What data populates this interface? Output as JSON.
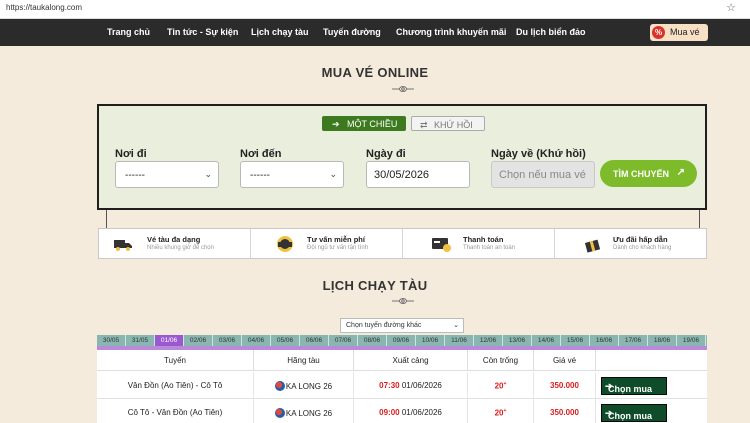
{
  "browser": {
    "url": "https://taukalong.com"
  },
  "nav": {
    "items": [
      "Trang chủ",
      "Tin tức - Sự kiện",
      "Lịch chạy tàu",
      "Tuyến đường",
      "Chương trình khuyến mãi",
      "Du lịch biển đảo"
    ],
    "buy_label": "Mua vé",
    "buy_icon": "%"
  },
  "booking": {
    "title": "MUA VÉ ONLINE",
    "tab_oneway": "MỘT CHIỀU",
    "tab_return": "KHỨ HỒI",
    "from_label": "Nơi đi",
    "from_value": "------",
    "to_label": "Nơi đến",
    "to_value": "------",
    "depart_label": "Ngày đi",
    "depart_value": "30/05/2026",
    "return_label": "Ngày về (Khứ hồi)",
    "return_placeholder": "Chọn nếu mua vé",
    "find_label": "TÌM CHUYẾN",
    "accent": "#7dbb2a"
  },
  "features": [
    {
      "title": "Vé tàu đa dạng",
      "sub": "Nhiều khung giờ để chọn",
      "icon": "truck-icon"
    },
    {
      "title": "Tư vấn miễn phí",
      "sub": "Đội ngũ tư vấn tận tình",
      "icon": "headset-icon"
    },
    {
      "title": "Thanh toán",
      "sub": "Thanh toán an toàn",
      "icon": "card-icon"
    },
    {
      "title": "Ưu đãi hấp dẫn",
      "sub": "Dành cho khách hàng",
      "icon": "gift-icon"
    }
  ],
  "schedule": {
    "title": "LỊCH CHẠY TÀU",
    "route_select": "Chọn tuyến đường khác",
    "dates": [
      "30/05",
      "31/05",
      "01/06",
      "02/06",
      "03/06",
      "04/06",
      "05/06",
      "06/06",
      "07/06",
      "08/06",
      "09/06",
      "10/06",
      "11/06",
      "12/06",
      "13/06",
      "14/06",
      "15/06",
      "16/06",
      "17/06",
      "18/06",
      "19/06"
    ],
    "active_date": "01/06",
    "headers": [
      "Tuyến",
      "Hãng tàu",
      "Xuất cảng",
      "Còn trống",
      "Giá vé"
    ],
    "rows": [
      {
        "route": "Vân Đồn (Ao Tiên) - Cô Tô",
        "carrier": "KA LONG 26",
        "time": "07:30",
        "date": "01/06/2026",
        "seats": "20",
        "price": "350.000",
        "action": "Chọn mua"
      },
      {
        "route": "Cô Tô - Vân Đồn (Ao Tiên)",
        "carrier": "KA LONG 26",
        "time": "09:00",
        "date": "01/06/2026",
        "seats": "20",
        "price": "350.000",
        "action": "Chọn mua"
      }
    ]
  }
}
